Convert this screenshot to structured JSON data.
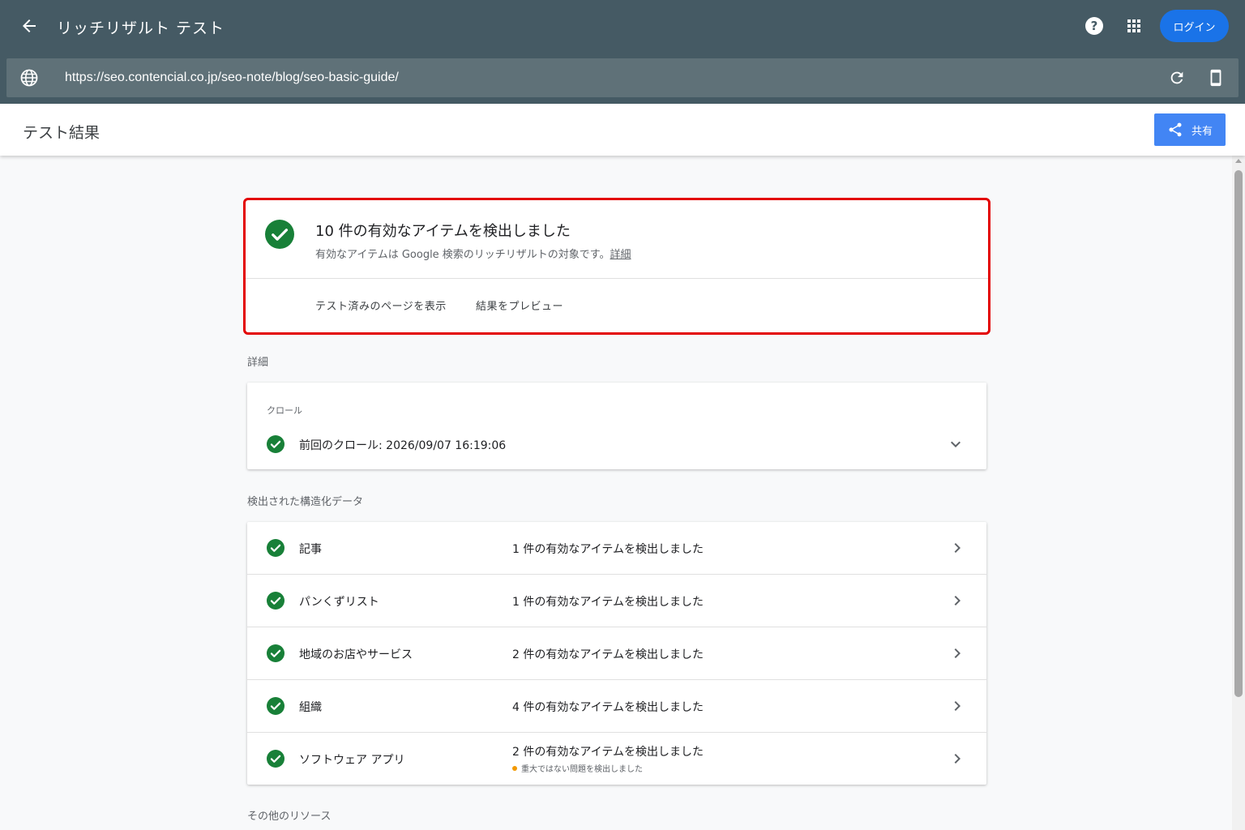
{
  "app": {
    "title": "リッチリザルト テスト",
    "login_label": "ログイン"
  },
  "url_bar": {
    "value": "https://seo.contencial.co.jp/seo-note/blog/seo-basic-guide/"
  },
  "subheader": {
    "title": "テスト結果",
    "share_label": "共有"
  },
  "summary": {
    "title": "10 件の有効なアイテムを検出しました",
    "subtitle": "有効なアイテムは Google 検索のリッチリザルトの対象です。",
    "details_link": "詳細",
    "actions": [
      "テスト済みのページを表示",
      "結果をプレビュー"
    ]
  },
  "details": {
    "section_label": "詳細",
    "crawl_label": "クロール",
    "last_crawl": "前回のクロール: 2026/09/07 16:19:06"
  },
  "structured_data": {
    "section_label": "検出された構造化データ",
    "items": [
      {
        "name": "記事",
        "status": "1 件の有効なアイテムを検出しました",
        "warning": ""
      },
      {
        "name": "パンくずリスト",
        "status": "1 件の有効なアイテムを検出しました",
        "warning": ""
      },
      {
        "name": "地域のお店やサービス",
        "status": "2 件の有効なアイテムを検出しました",
        "warning": ""
      },
      {
        "name": "組織",
        "status": "4 件の有効なアイテムを検出しました",
        "warning": ""
      },
      {
        "name": "ソフトウェア アプリ",
        "status": "2 件の有効なアイテムを検出しました",
        "warning": "重大ではない問題を検出しました"
      }
    ]
  },
  "other_resources": {
    "section_label": "その他のリソース"
  },
  "colors": {
    "appbar": "#455a64",
    "urlbar": "#5f7178",
    "accent_blue": "#1a73e8",
    "share_blue": "#4285f4",
    "success_green": "#188038",
    "highlight_red": "#e30000",
    "warning_orange": "#f29900"
  },
  "icons": {
    "back": "arrow-back-icon",
    "help": "help-icon",
    "apps": "apps-grid-icon",
    "globe": "globe-icon",
    "reload": "reload-icon",
    "device": "smartphone-icon",
    "share": "share-icon",
    "check": "check-circle-icon",
    "expand": "chevron-down-icon",
    "row_arrow": "chevron-right-icon"
  }
}
